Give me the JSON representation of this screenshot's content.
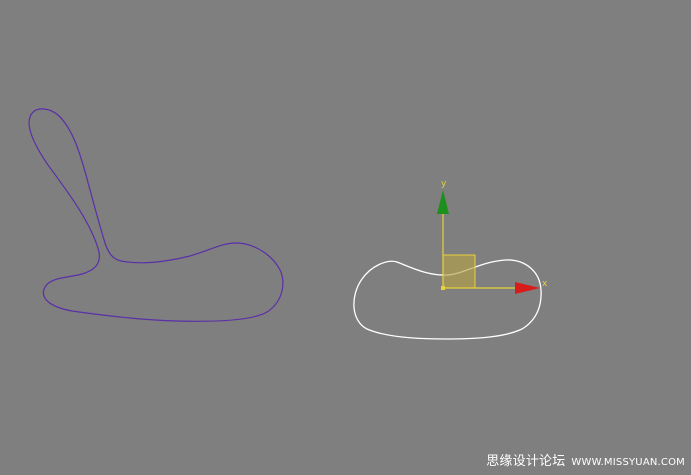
{
  "viewport": {
    "background_color": "#7f7f7f"
  },
  "shapes": {
    "chair_spline_color": "#5a2fa8",
    "seat_spline_color": "#ffffff"
  },
  "gizmo": {
    "y_label": "y",
    "x_label": "x",
    "y_axis_color": "#1c8f1c",
    "x_axis_color": "#d81c1c",
    "line_color": "#e8d23a",
    "plane_color": "#b3a24a"
  },
  "watermark": {
    "chinese_text": "思缘设计论坛",
    "url_text": "WWW.MISSYUAN.COM"
  }
}
